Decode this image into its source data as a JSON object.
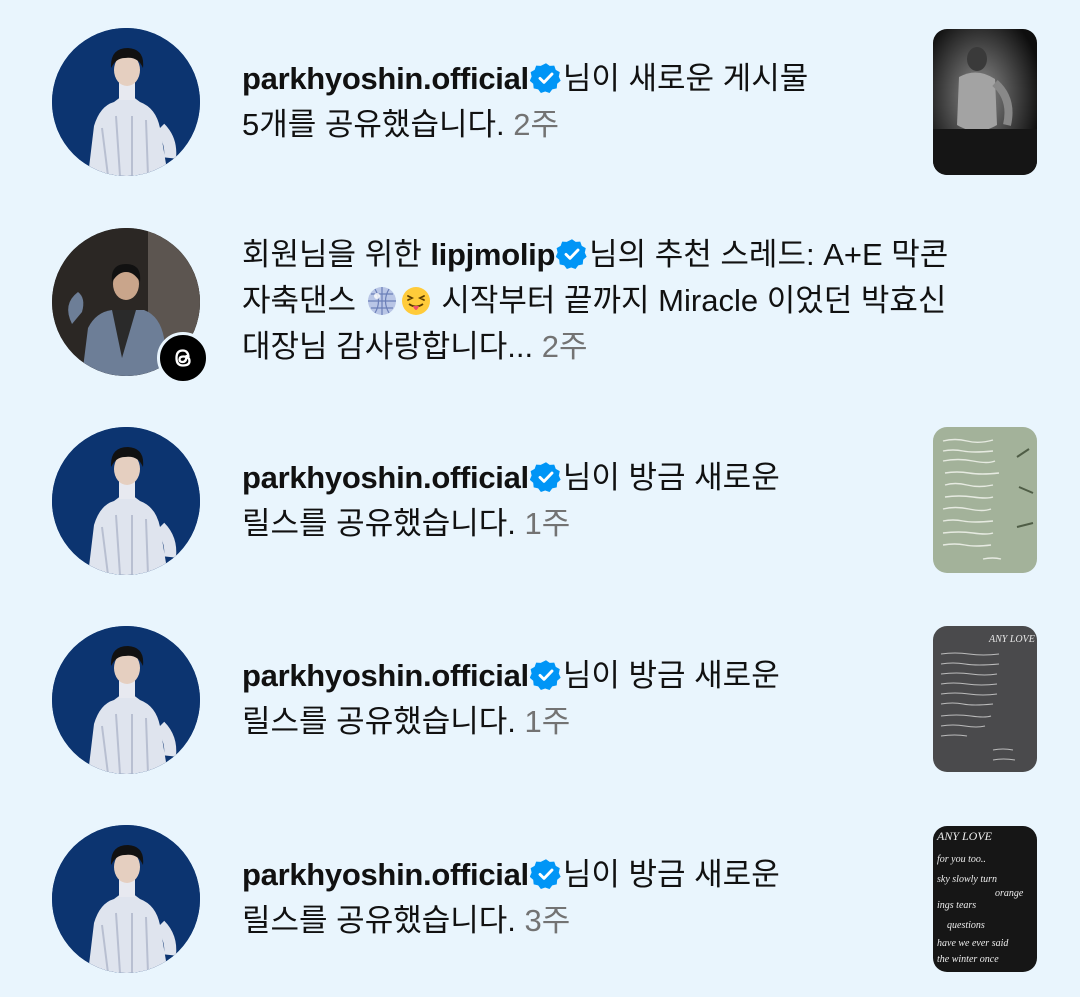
{
  "notifications": [
    {
      "username": "parkhyoshin.official",
      "line1_suffix": "님이 새로운 게시물",
      "line2": "5개를 공유했습니다.",
      "time": "2주",
      "thumbnail": "shirtless-man-photo"
    },
    {
      "prefix": "회원님을 위한 ",
      "username": "lipjmolip",
      "line1_suffix": "님의 추천 스레드: A+E 막콘",
      "line2_a": "자축댄스 ",
      "emojis": [
        "🪩",
        "😝"
      ],
      "line2_b": " 시작부터 끝까지 Miracle 이었던 박효신",
      "line3": "대장님 감사랑합니다...",
      "time": "2주",
      "badge": "threads-icon"
    },
    {
      "username": "parkhyoshin.official",
      "line1_suffix": "님이 방금 새로운",
      "line2": "릴스를 공유했습니다.",
      "time": "1주",
      "thumbnail": "green-handwritten-lyrics"
    },
    {
      "username": "parkhyoshin.official",
      "line1_suffix": "님이 방금 새로운",
      "line2": "릴스를 공유했습니다.",
      "time": "1주",
      "thumbnail": "grey-handwritten-lyrics",
      "thumb_title": "ANY LOVE"
    },
    {
      "username": "parkhyoshin.official",
      "line1_suffix": "님이 방금 새로운",
      "line2": "릴스를 공유했습니다.",
      "time": "3주",
      "thumbnail": "black-handwritten-lyrics",
      "thumb_title": "ANY LOVE",
      "thumb_lines": [
        "for you too..",
        "sky slowly turn",
        "orange",
        "ings tears",
        "questions",
        "have we ever said",
        "the winter once"
      ]
    }
  ],
  "colors": {
    "background": "#e9f5fd",
    "verified": "#0095f6",
    "timestamp": "#737373"
  }
}
